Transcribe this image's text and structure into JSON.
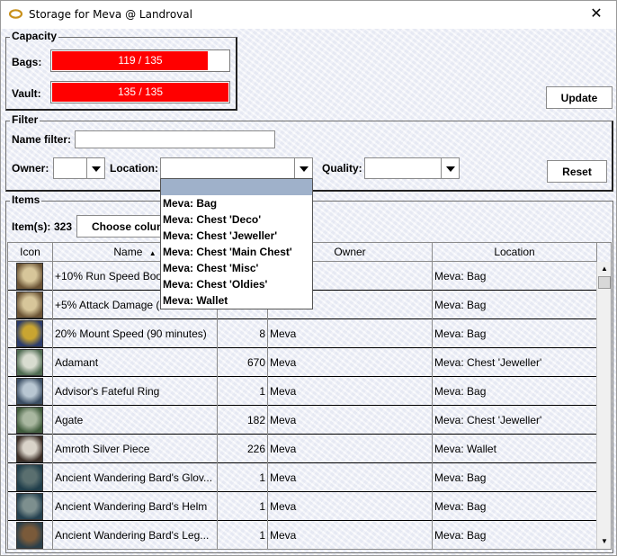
{
  "window": {
    "title": "Storage for Meva @ Landroval",
    "close_glyph": "✕"
  },
  "capacity": {
    "legend": "Capacity",
    "bags_label": "Bags:",
    "bags_text": "119 / 135",
    "bags_fraction": 0.881,
    "vault_label": "Vault:",
    "vault_text": "135 / 135",
    "vault_fraction": 1.0,
    "bar_color": "#ff0000",
    "update_label": "Update"
  },
  "filter": {
    "legend": "Filter",
    "name_filter_label": "Name filter:",
    "name_filter_value": "",
    "owner_label": "Owner:",
    "owner_value": "",
    "location_label": "Location:",
    "location_value": "",
    "quality_label": "Quality:",
    "quality_value": "",
    "reset_label": "Reset",
    "location_options": [
      "Meva: Bag",
      "Meva: Chest 'Deco'",
      "Meva: Chest 'Jeweller'",
      "Meva: Chest 'Main Chest'",
      "Meva: Chest 'Misc'",
      "Meva: Chest 'Oldies'",
      "Meva: Wallet"
    ]
  },
  "items": {
    "legend": "Items",
    "count_label": "Item(s):",
    "count_value": "323",
    "choose_columns_label": "Choose colum",
    "columns": [
      "Icon",
      "Name",
      "Owner",
      "Location"
    ],
    "sort_glyph": "▲",
    "rows": [
      {
        "icon": "scroll-icon",
        "name": "+10% Run Speed Boo",
        "qty": "",
        "owner": "",
        "location": "Meva: Bag"
      },
      {
        "icon": "scroll-icon",
        "name": "+5% Attack Damage (",
        "qty": "",
        "owner": "",
        "location": "Meva: Bag"
      },
      {
        "icon": "horse-icon",
        "name": "20% Mount Speed (90 minutes)",
        "qty": "8",
        "owner": "Meva",
        "location": "Meva: Bag"
      },
      {
        "icon": "ore-icon",
        "name": "Adamant",
        "qty": "670",
        "owner": "Meva",
        "location": "Meva: Chest 'Jeweller'"
      },
      {
        "icon": "ring-icon",
        "name": "Advisor's Fateful Ring",
        "qty": "1",
        "owner": "Meva",
        "location": "Meva: Bag"
      },
      {
        "icon": "gem-icon",
        "name": "Agate",
        "qty": "182",
        "owner": "Meva",
        "location": "Meva: Chest 'Jeweller'"
      },
      {
        "icon": "coin-icon",
        "name": "Amroth Silver Piece",
        "qty": "226",
        "owner": "Meva",
        "location": "Meva: Wallet"
      },
      {
        "icon": "gloves-icon",
        "name": "Ancient Wandering Bard's Glov...",
        "qty": "1",
        "owner": "Meva",
        "location": "Meva: Bag"
      },
      {
        "icon": "helm-icon",
        "name": "Ancient Wandering Bard's Helm",
        "qty": "1",
        "owner": "Meva",
        "location": "Meva: Bag"
      },
      {
        "icon": "leggings-icon",
        "name": "Ancient Wandering Bard's Leg...",
        "qty": "1",
        "owner": "Meva",
        "location": "Meva: Bag"
      }
    ]
  }
}
